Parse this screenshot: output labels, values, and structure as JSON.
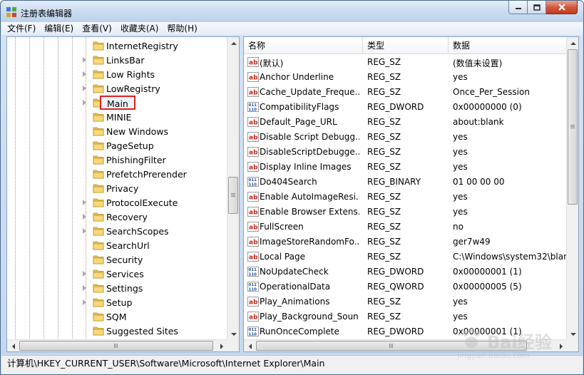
{
  "window": {
    "title": "注册表编辑器"
  },
  "menu": [
    "文件(F)",
    "编辑(E)",
    "查看(V)",
    "收藏夹(A)",
    "帮助(H)"
  ],
  "tree": {
    "selected": "Main",
    "items": [
      {
        "label": "InternetRegistry",
        "expandable": false
      },
      {
        "label": "LinksBar",
        "expandable": true
      },
      {
        "label": "Low Rights",
        "expandable": true
      },
      {
        "label": "LowRegistry",
        "expandable": true
      },
      {
        "label": "Main",
        "expandable": true
      },
      {
        "label": "MINIE",
        "expandable": false
      },
      {
        "label": "New Windows",
        "expandable": false
      },
      {
        "label": "PageSetup",
        "expandable": false
      },
      {
        "label": "PhishingFilter",
        "expandable": false
      },
      {
        "label": "PrefetchPrerender",
        "expandable": false
      },
      {
        "label": "Privacy",
        "expandable": false
      },
      {
        "label": "ProtocolExecute",
        "expandable": true
      },
      {
        "label": "Recovery",
        "expandable": true
      },
      {
        "label": "SearchScopes",
        "expandable": true
      },
      {
        "label": "SearchUrl",
        "expandable": false
      },
      {
        "label": "Security",
        "expandable": false
      },
      {
        "label": "Services",
        "expandable": true
      },
      {
        "label": "Settings",
        "expandable": true
      },
      {
        "label": "Setup",
        "expandable": true
      },
      {
        "label": "SQM",
        "expandable": false
      },
      {
        "label": "Suggested Sites",
        "expandable": false
      }
    ]
  },
  "columns": {
    "name": "名称",
    "type": "类型",
    "data": "数据"
  },
  "values": [
    {
      "icon": "ab",
      "name": "(默认)",
      "type": "REG_SZ",
      "data": "(数值未设置)"
    },
    {
      "icon": "ab",
      "name": "Anchor Underline",
      "type": "REG_SZ",
      "data": "yes"
    },
    {
      "icon": "ab",
      "name": "Cache_Update_Freque...",
      "type": "REG_SZ",
      "data": "Once_Per_Session"
    },
    {
      "icon": "bin",
      "name": "CompatibilityFlags",
      "type": "REG_DWORD",
      "data": "0x00000000 (0)"
    },
    {
      "icon": "ab",
      "name": "Default_Page_URL",
      "type": "REG_SZ",
      "data": "about:blank"
    },
    {
      "icon": "ab",
      "name": "Disable Script Debugg...",
      "type": "REG_SZ",
      "data": "yes"
    },
    {
      "icon": "ab",
      "name": "DisableScriptDebugge...",
      "type": "REG_SZ",
      "data": "yes"
    },
    {
      "icon": "ab",
      "name": "Display Inline Images",
      "type": "REG_SZ",
      "data": "yes"
    },
    {
      "icon": "bin",
      "name": "Do404Search",
      "type": "REG_BINARY",
      "data": "01 00 00 00"
    },
    {
      "icon": "ab",
      "name": "Enable AutoImageResi...",
      "type": "REG_SZ",
      "data": "yes"
    },
    {
      "icon": "ab",
      "name": "Enable Browser Extens...",
      "type": "REG_SZ",
      "data": "yes"
    },
    {
      "icon": "ab",
      "name": "FullScreen",
      "type": "REG_SZ",
      "data": "no"
    },
    {
      "icon": "ab",
      "name": "ImageStoreRandomFo...",
      "type": "REG_SZ",
      "data": "ger7w49"
    },
    {
      "icon": "ab",
      "name": "Local Page",
      "type": "REG_SZ",
      "data": "C:\\Windows\\system32\\blan"
    },
    {
      "icon": "bin",
      "name": "NoUpdateCheck",
      "type": "REG_DWORD",
      "data": "0x00000001 (1)"
    },
    {
      "icon": "bin",
      "name": "OperationalData",
      "type": "REG_QWORD",
      "data": "0x00000005 (5)"
    },
    {
      "icon": "ab",
      "name": "Play_Animations",
      "type": "REG_SZ",
      "data": "yes"
    },
    {
      "icon": "ab",
      "name": "Play_Background_Soun...",
      "type": "REG_SZ",
      "data": "yes"
    },
    {
      "icon": "bin",
      "name": "RunOnceComplete",
      "type": "REG_DWORD",
      "data": "0x00000001 (1)"
    }
  ],
  "status": {
    "path": "计算机\\HKEY_CURRENT_USER\\Software\\Microsoft\\Internet Explorer\\Main"
  },
  "watermark": {
    "text": "Bai经验",
    "sub": "jingyan.baidu.com"
  }
}
